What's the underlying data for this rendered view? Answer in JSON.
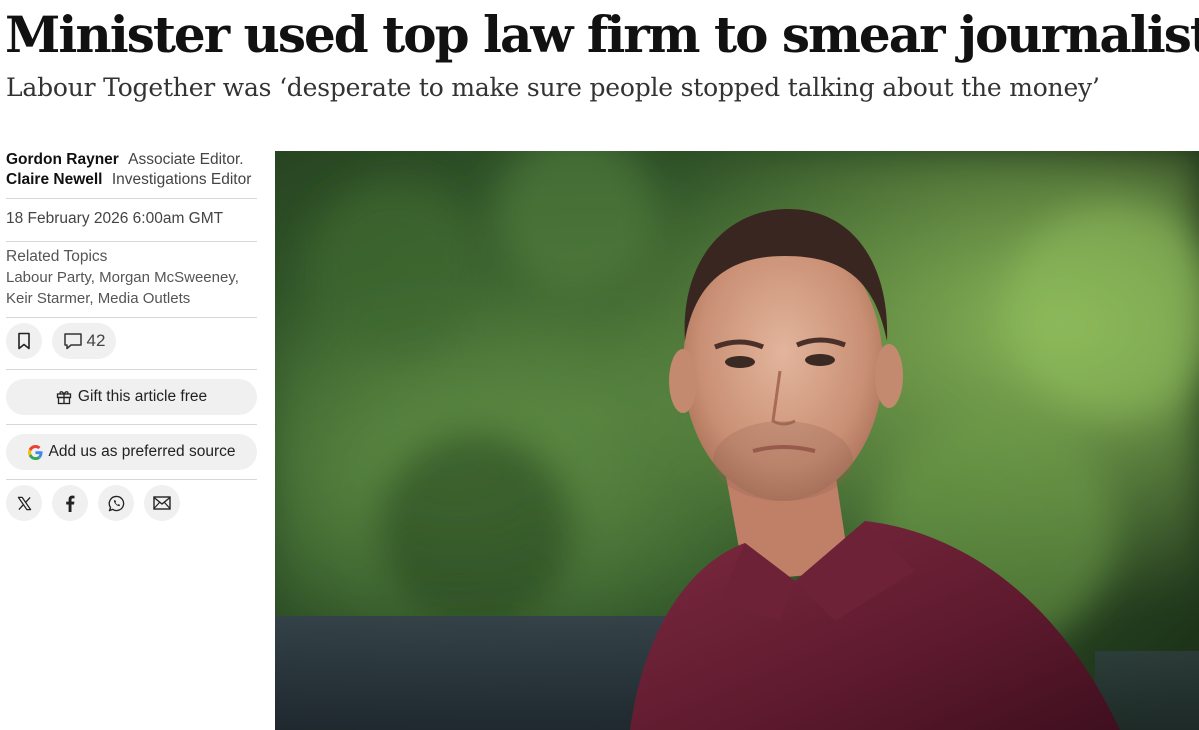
{
  "article": {
    "headline": "Minister used top law firm to smear journalist",
    "standfirst": "Labour Together was ‘desperate to make sure people stopped talking about the money’"
  },
  "authors": [
    {
      "name": "Gordon Rayner",
      "role": "Associate Editor."
    },
    {
      "name": "Claire Newell",
      "role": "Investigations Editor"
    }
  ],
  "published": "18 February 2026 6:00am GMT",
  "topics": {
    "title": "Related Topics",
    "line1": "Labour Party, Morgan McSweeney,",
    "line2": "Keir Starmer, Media Outlets"
  },
  "actions": {
    "bookmark_icon": "bookmark-icon",
    "comment_icon": "comment-icon",
    "comment_count": "42",
    "gift_label": "Gift this article free",
    "gift_icon": "gift-icon",
    "preferred_label": "Add us as preferred source",
    "preferred_icon": "google-icon"
  },
  "share": [
    "x-icon",
    "facebook-icon",
    "whatsapp-icon",
    "email-icon"
  ],
  "colors": {
    "button_bg": "#f0f0f0",
    "google_blue": "#4285F4",
    "google_red": "#EA4335",
    "google_yellow": "#FBBC05",
    "google_green": "#34A853",
    "shirt": "#6b1f33"
  }
}
